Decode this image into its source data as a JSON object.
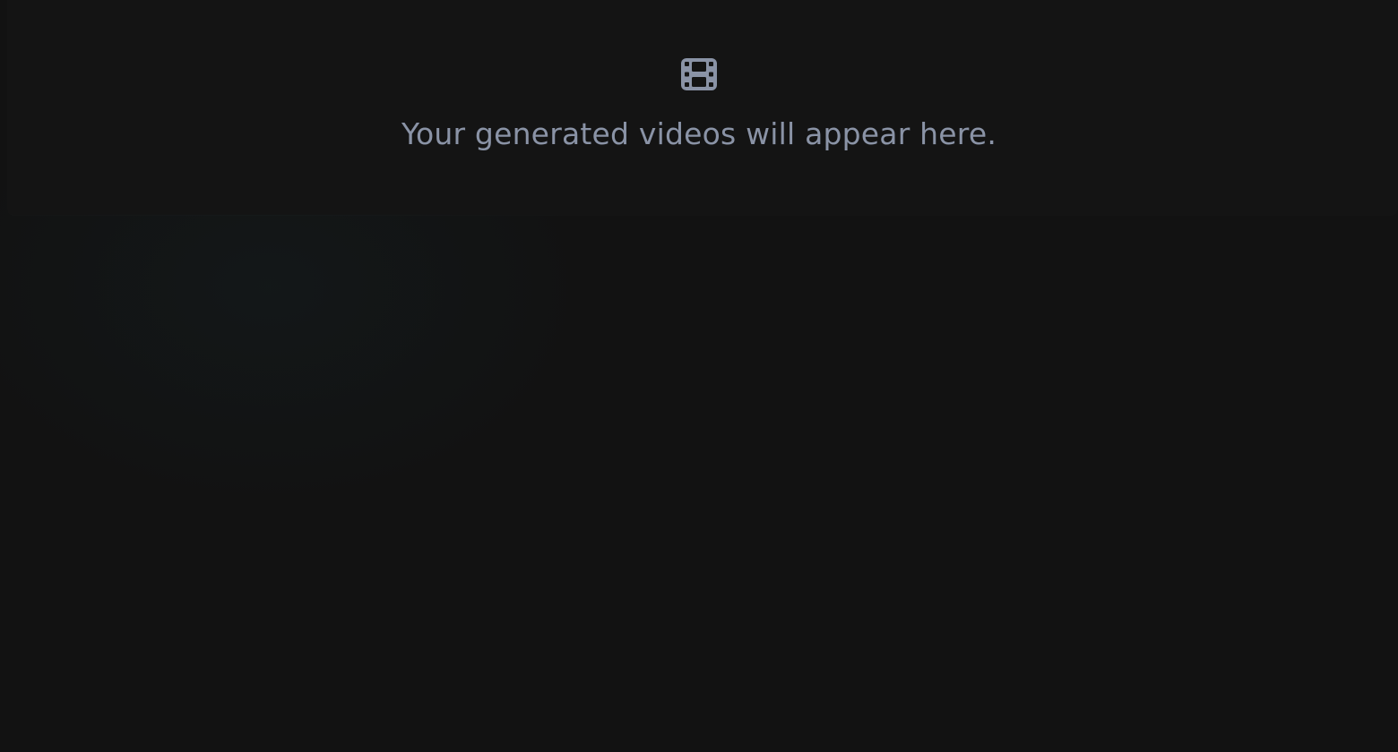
{
  "empty_state": {
    "icon": "film-icon",
    "message": "Your generated videos will appear here."
  },
  "colors": {
    "background": "#121212",
    "panel": "#141414",
    "muted_text": "#8a93a6"
  }
}
